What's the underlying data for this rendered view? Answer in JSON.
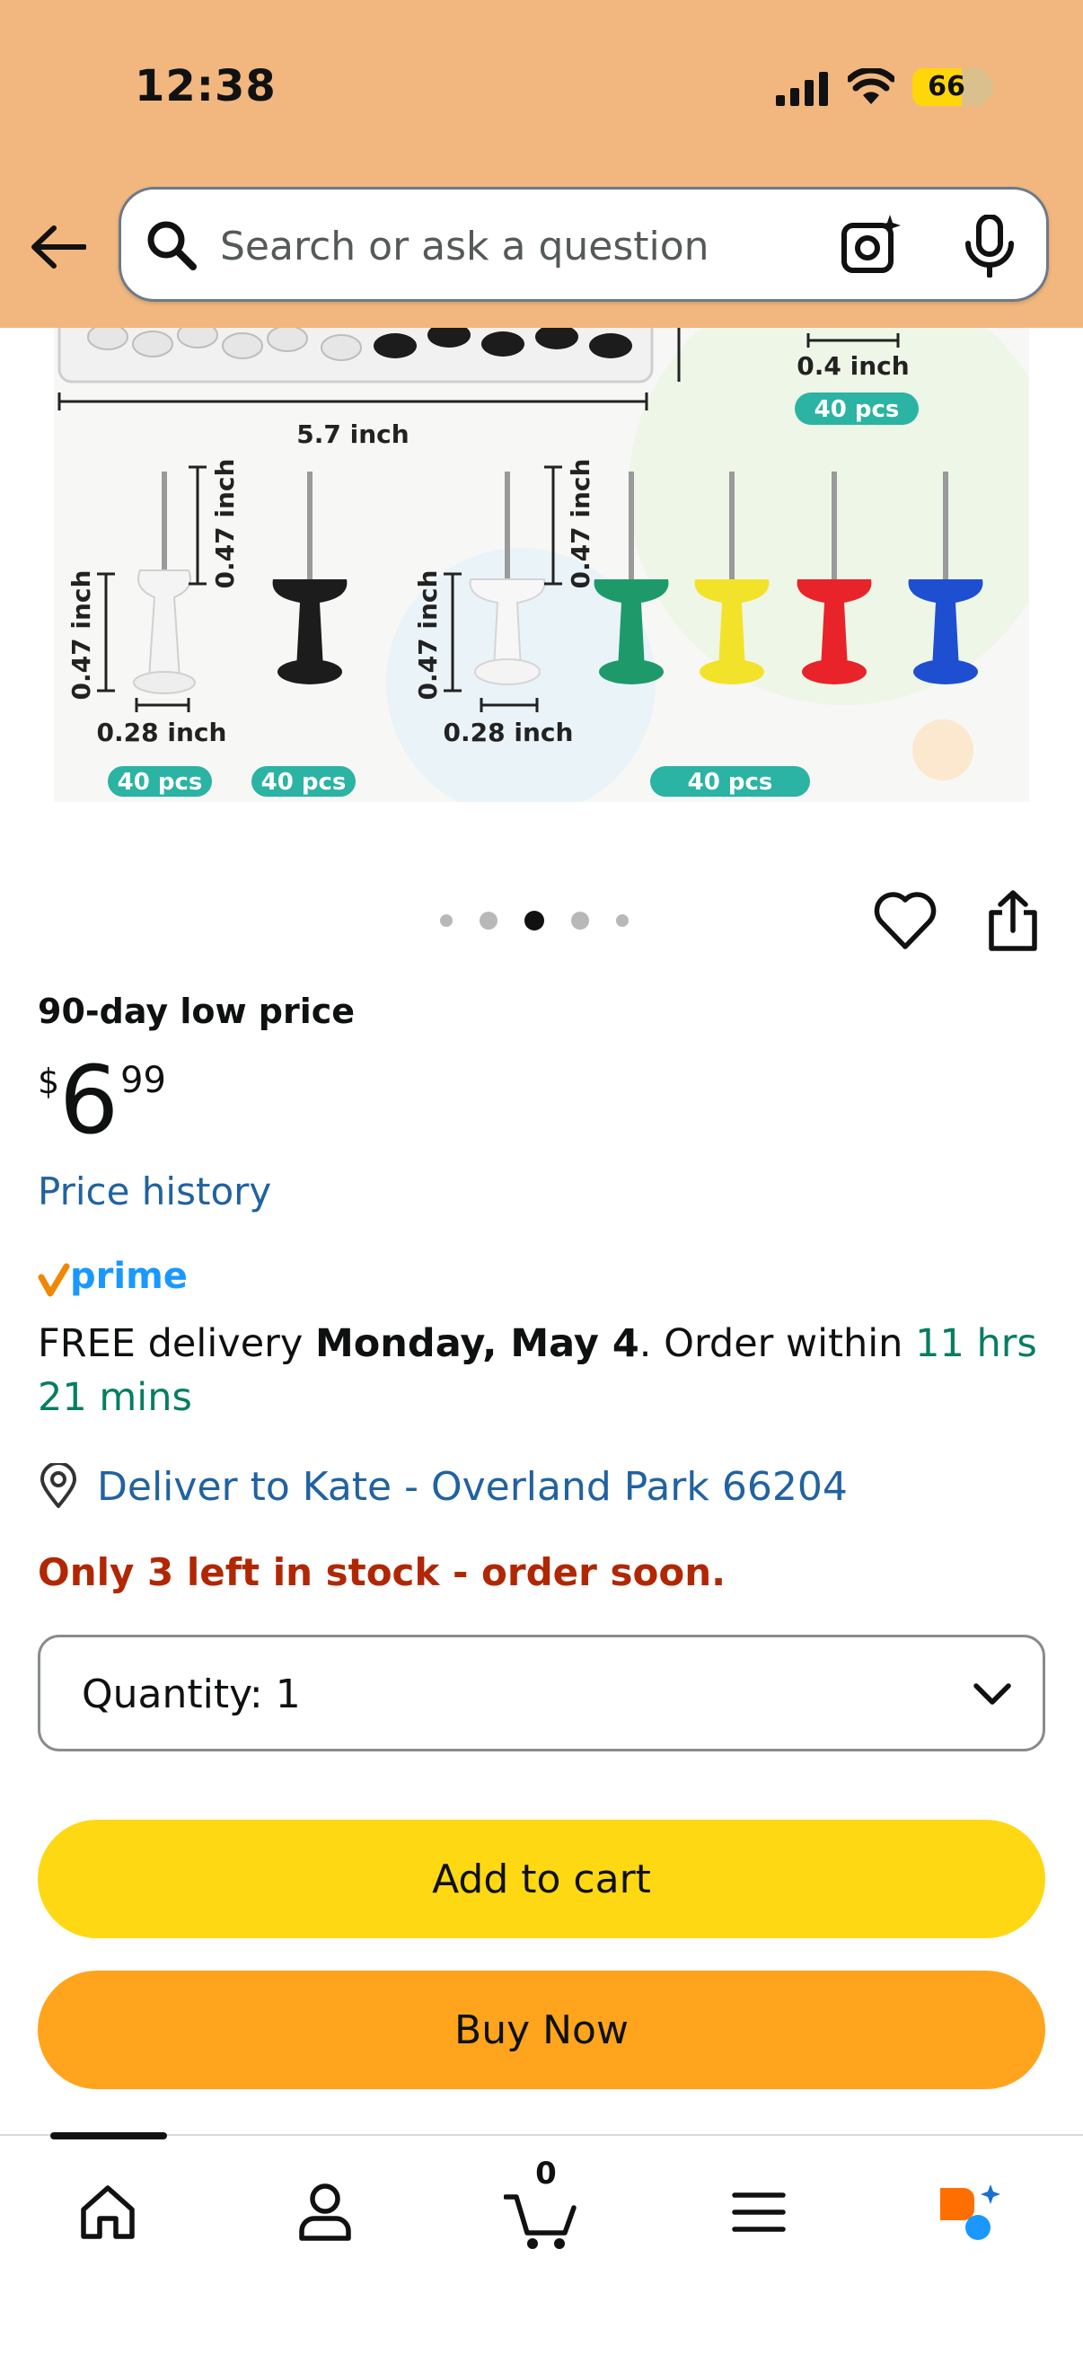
{
  "status_bar": {
    "time": "12:38",
    "battery": "66",
    "battery_level": 0.66
  },
  "search": {
    "placeholder": "Search or ask a question"
  },
  "product_image": {
    "labels": {
      "width_57": "5.7 inch",
      "height_04": "0.4 inch",
      "pcs": "40 pcs",
      "h047": "0.47 inch",
      "w028": "0.28 inch"
    }
  },
  "carousel": {
    "count": 5,
    "active_index": 2
  },
  "product": {
    "deal_label": "90-day low price",
    "price_symbol": "$",
    "price_whole": "6",
    "price_fraction": "99",
    "price_history": "Price history",
    "prime": "prime",
    "delivery_prefix": "FREE delivery ",
    "delivery_date": "Monday, May 4",
    "delivery_mid": ". Order within ",
    "delivery_countdown": "11 hrs 21 mins",
    "deliver_to": "Deliver to Kate - Overland Park 66204",
    "stock": "Only 3 left in stock - order soon.",
    "quantity_label": "Quantity: 1"
  },
  "buttons": {
    "add_to_cart": "Add to cart",
    "buy_now": "Buy Now"
  },
  "bottom_nav": {
    "cart_count": "0"
  },
  "colors": {
    "header_bg": "#f1b77f",
    "link": "#2162a1",
    "green": "#067d62",
    "stock_red": "#b12704",
    "add_to_cart": "#ffd814",
    "buy_now": "#ffa41c",
    "prime_blue": "#1a98ff",
    "prime_check": "#f08804"
  }
}
